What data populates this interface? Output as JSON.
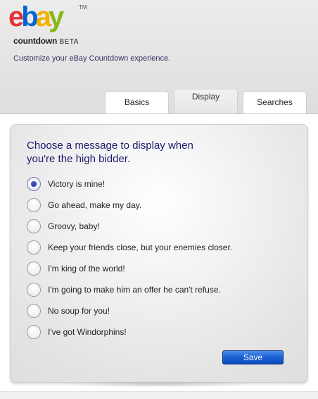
{
  "header": {
    "logo_letters": [
      "e",
      "b",
      "a",
      "y"
    ],
    "logo_tm": "TM",
    "product_name": "countdown",
    "product_tag": "BETA",
    "subtitle": "Customize your eBay Countdown experience."
  },
  "tabs": [
    {
      "label": "Basics",
      "active": false
    },
    {
      "label": "Display",
      "active": true
    },
    {
      "label": "Searches",
      "active": false
    }
  ],
  "panel": {
    "prompt": "Choose a message to display when you're the high bidder.",
    "options": [
      {
        "label": "Victory is mine!",
        "checked": true
      },
      {
        "label": "Go ahead, make my day.",
        "checked": false
      },
      {
        "label": "Groovy, baby!",
        "checked": false
      },
      {
        "label": "Keep your friends close, but your enemies closer.",
        "checked": false
      },
      {
        "label": "I'm king of the world!",
        "checked": false
      },
      {
        "label": "I'm going to make him an offer he can't refuse.",
        "checked": false
      },
      {
        "label": "No soup for you!",
        "checked": false
      },
      {
        "label": "I've got Windorphins!",
        "checked": false
      }
    ],
    "save_label": "Save"
  },
  "colors": {
    "prompt_text": "#1a1a6e",
    "save_button": "#1a5fd0",
    "radio_selected": "#0f1f8a"
  }
}
